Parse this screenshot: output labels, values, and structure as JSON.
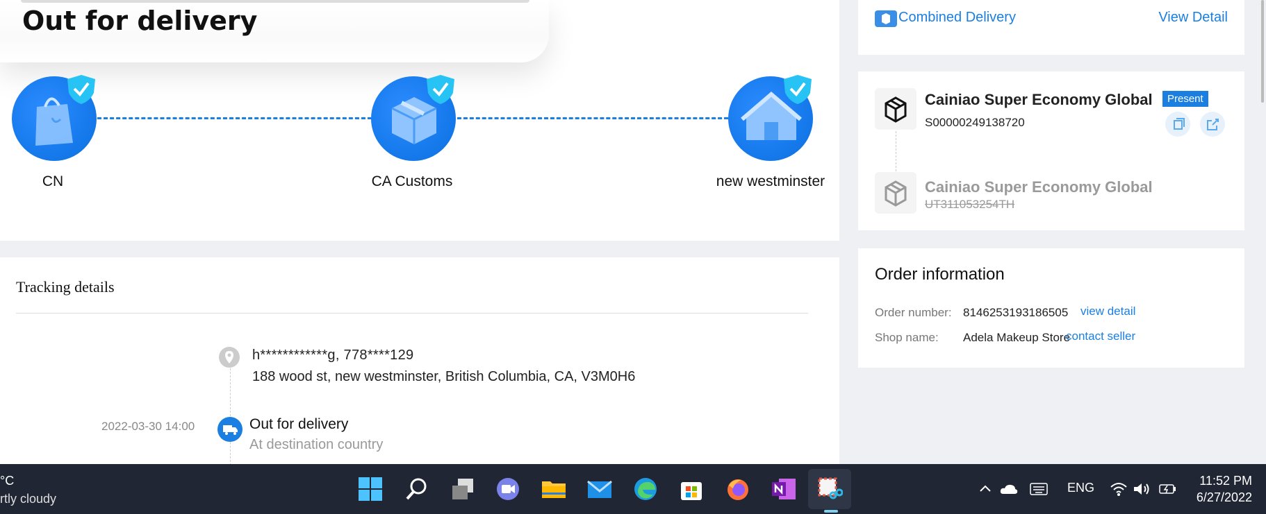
{
  "status": {
    "title": "Out for delivery"
  },
  "stages": [
    {
      "label": "CN"
    },
    {
      "label": "CA Customs"
    },
    {
      "label": "new westminster"
    }
  ],
  "tracking": {
    "title": "Tracking details",
    "address_line1": "h************g,  778****129",
    "address_line2": "188 wood st,  new westminster,  British Columbia,  CA,  V3M0H6",
    "event": {
      "time": "2022-03-30 14:00",
      "title": "Out for delivery",
      "subtitle": "At destination country"
    }
  },
  "combined": {
    "label": "Combined Delivery",
    "link": "View Detail"
  },
  "carriers": [
    {
      "name": "Cainiao Super Economy Global",
      "number": "S00000249138720",
      "badge": "Present"
    },
    {
      "name": "Cainiao Super Economy Global",
      "number": "UT311053254TH"
    }
  ],
  "order": {
    "title": "Order information",
    "number_label": "Order number:",
    "number": "8146253193186505",
    "number_link": "view detail",
    "shop_label": "Shop name:",
    "shop": "Adela Makeup Store",
    "shop_link": "contact seller"
  },
  "taskbar": {
    "weather_temp": "°C",
    "weather_desc": "rtly cloudy",
    "language": "ENG",
    "time": "11:52 PM",
    "date": "6/27/2022"
  },
  "colors": {
    "accent": "#1a7fe0",
    "taskbar": "#202634"
  }
}
